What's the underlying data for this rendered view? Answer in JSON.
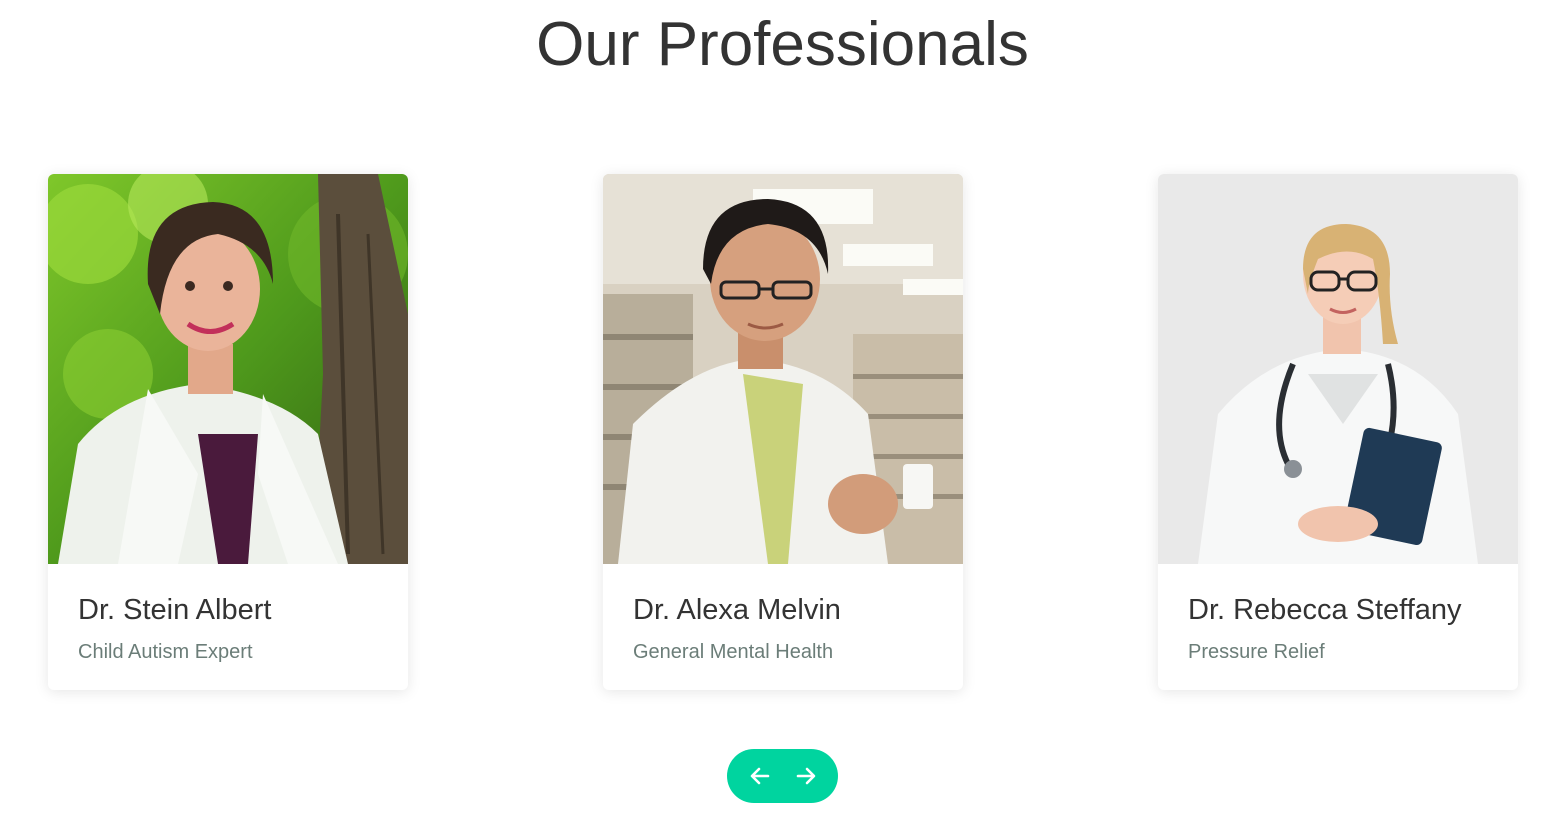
{
  "section": {
    "title": "Our Professionals"
  },
  "professionals": [
    {
      "name": "Dr. Stein Albert",
      "role": "Child Autism Expert",
      "photo_icon": "doctor-photo-woman-outdoor"
    },
    {
      "name": "Dr. Alexa Melvin",
      "role": "General Mental Health",
      "photo_icon": "doctor-photo-man-pharmacy"
    },
    {
      "name": "Dr. Rebecca Steffany",
      "role": "Pressure Relief",
      "photo_icon": "doctor-photo-woman-stethoscope"
    }
  ],
  "carousel": {
    "prev_icon": "arrow-left-icon",
    "next_icon": "arrow-right-icon"
  },
  "colors": {
    "accent": "#00d49f",
    "title": "#333333",
    "role_text": "#6b7d78"
  }
}
